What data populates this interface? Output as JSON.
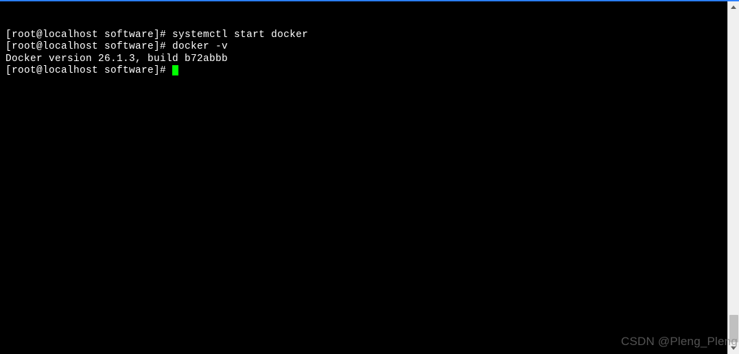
{
  "terminal": {
    "lines": [
      {
        "prompt": "[root@localhost software]# ",
        "command": "systemctl start docker"
      },
      {
        "prompt": "[root@localhost software]# ",
        "command": "docker -v"
      },
      {
        "output": "Docker version 26.1.3, build b72abbb"
      },
      {
        "prompt": "[root@localhost software]# ",
        "cursor": true
      }
    ]
  },
  "watermark": "CSDN @Pleng_Pleng"
}
